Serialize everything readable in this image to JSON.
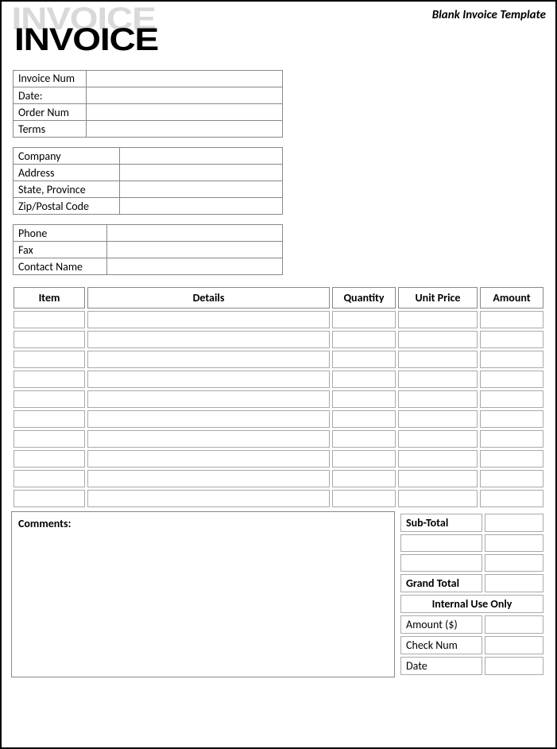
{
  "header_label": "Blank Invoice Template",
  "logo_text": "INVOICE",
  "info1": {
    "invoice_num_label": "Invoice Num",
    "invoice_num": "",
    "date_label": "Date:",
    "date": "",
    "order_num_label": "Order Num",
    "order_num": "",
    "terms_label": "Terms",
    "terms": ""
  },
  "info2": {
    "company_label": "Company",
    "company": "",
    "address_label": "Address",
    "address": "",
    "state_label": "State, Province",
    "state": "",
    "zip_label": "Zip/Postal Code",
    "zip": ""
  },
  "info3": {
    "phone_label": "Phone",
    "phone": "",
    "fax_label": "Fax",
    "fax": "",
    "contact_label": "Contact Name",
    "contact": ""
  },
  "items": {
    "headers": {
      "item": "Item",
      "details": "Details",
      "quantity": "Quantity",
      "unit_price": "Unit Price",
      "amount": "Amount"
    },
    "rows": [
      {
        "item": "",
        "details": "",
        "quantity": "",
        "unit_price": "",
        "amount": ""
      },
      {
        "item": "",
        "details": "",
        "quantity": "",
        "unit_price": "",
        "amount": ""
      },
      {
        "item": "",
        "details": "",
        "quantity": "",
        "unit_price": "",
        "amount": ""
      },
      {
        "item": "",
        "details": "",
        "quantity": "",
        "unit_price": "",
        "amount": ""
      },
      {
        "item": "",
        "details": "",
        "quantity": "",
        "unit_price": "",
        "amount": ""
      },
      {
        "item": "",
        "details": "",
        "quantity": "",
        "unit_price": "",
        "amount": ""
      },
      {
        "item": "",
        "details": "",
        "quantity": "",
        "unit_price": "",
        "amount": ""
      },
      {
        "item": "",
        "details": "",
        "quantity": "",
        "unit_price": "",
        "amount": ""
      },
      {
        "item": "",
        "details": "",
        "quantity": "",
        "unit_price": "",
        "amount": ""
      },
      {
        "item": "",
        "details": "",
        "quantity": "",
        "unit_price": "",
        "amount": ""
      }
    ]
  },
  "comments_label": "Comments:",
  "totals": {
    "subtotal_label": "Sub-Total",
    "subtotal": "",
    "blank1_label": "",
    "blank1_val": "",
    "blank2_label": "",
    "blank2_val": "",
    "grand_total_label": "Grand Total",
    "grand_total": "",
    "internal_label": "Internal Use Only",
    "amount_label": "Amount ($)",
    "amount": "",
    "check_label": "Check Num",
    "check": "",
    "date_label": "Date",
    "date": ""
  }
}
